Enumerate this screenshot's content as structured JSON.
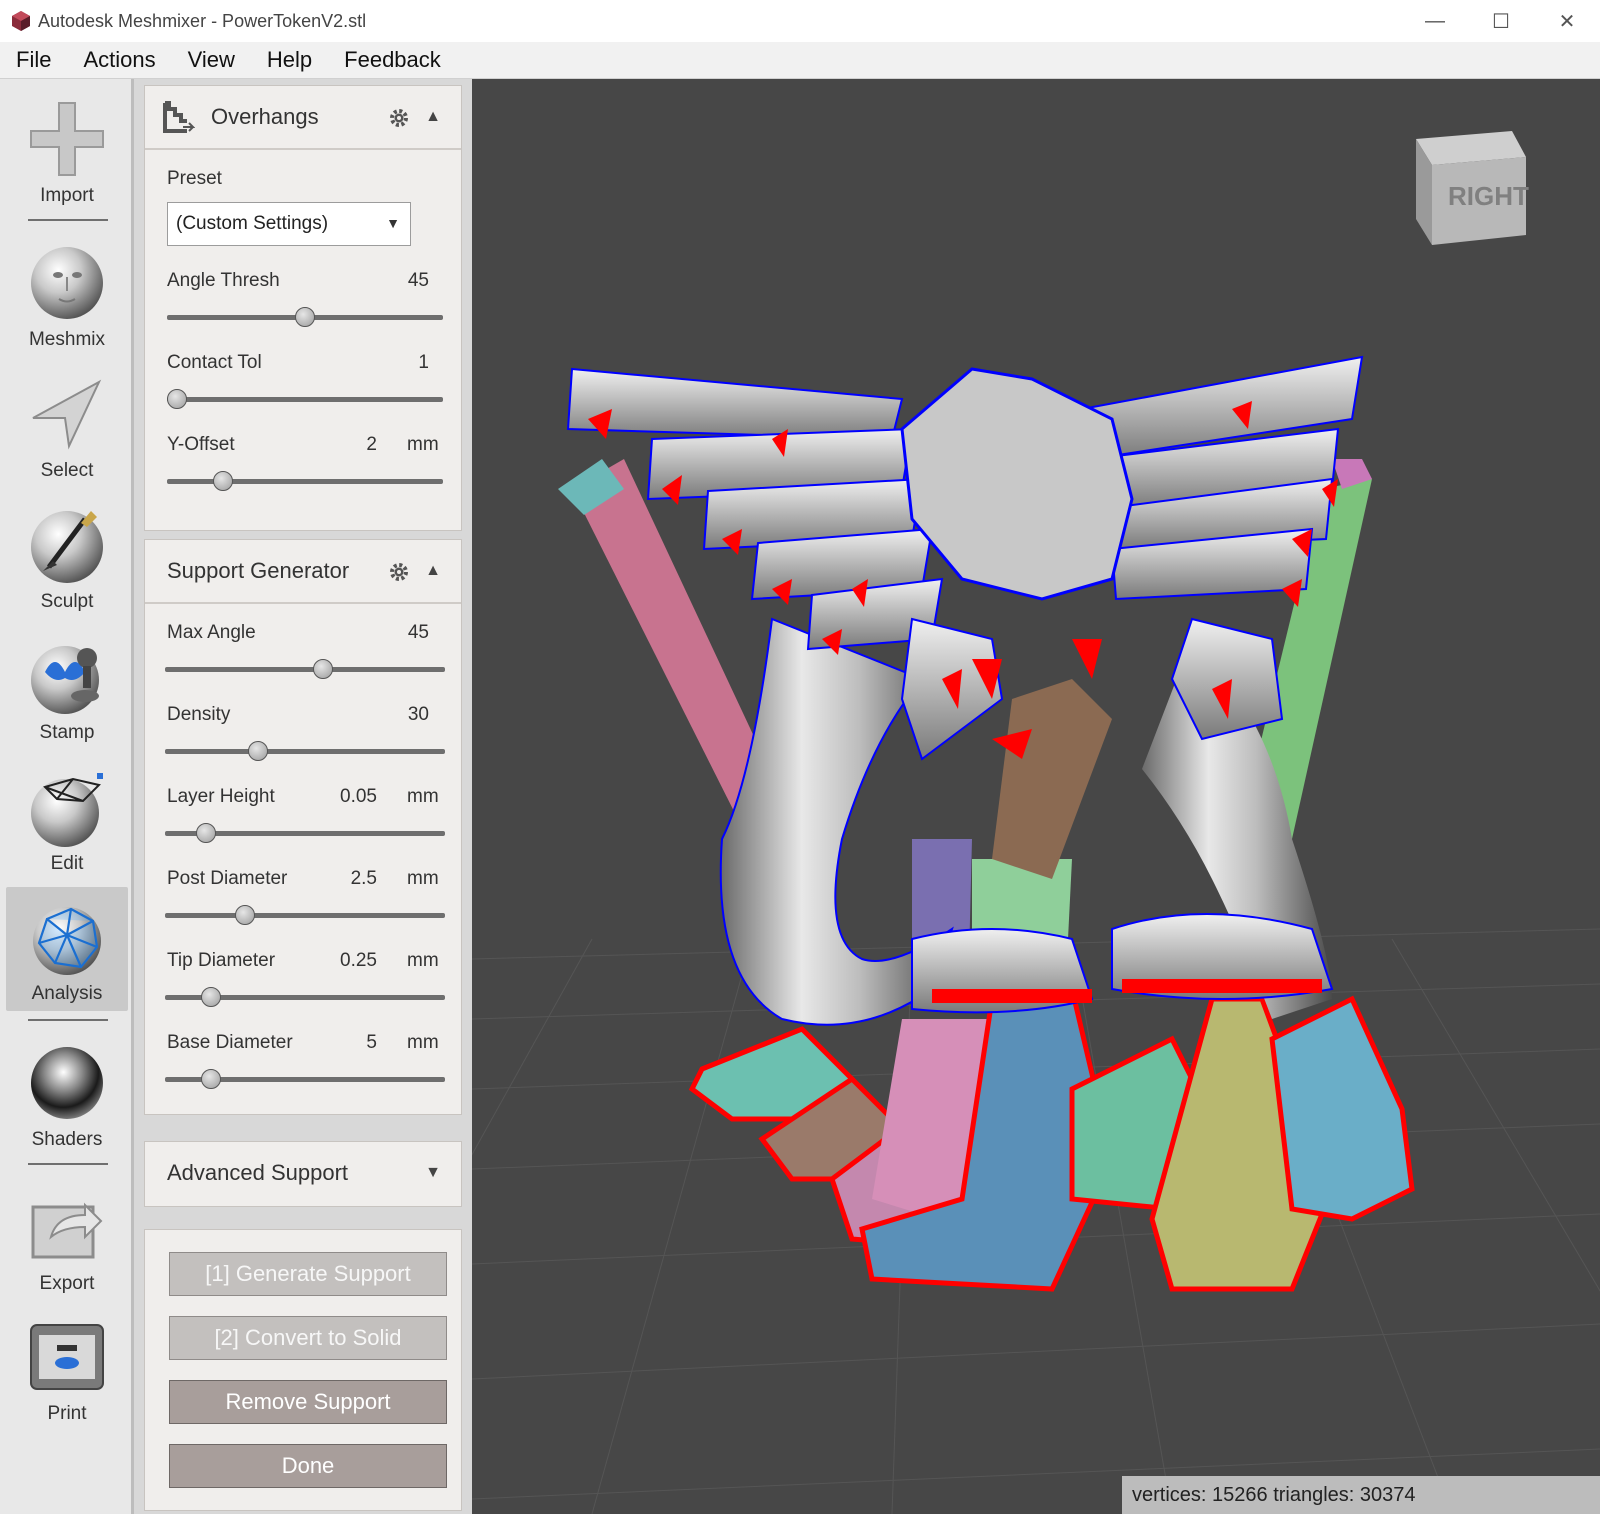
{
  "window": {
    "title": "Autodesk Meshmixer - PowerTokenV2.stl",
    "minimize": "—",
    "maximize": "☐",
    "close": "✕"
  },
  "menu": [
    "File",
    "Actions",
    "View",
    "Help",
    "Feedback"
  ],
  "tools": [
    {
      "label": "Import",
      "icon": "plus-icon"
    },
    {
      "label": "Meshmix",
      "icon": "face-sphere-icon"
    },
    {
      "label": "Select",
      "icon": "cursor-arrow-icon"
    },
    {
      "label": "Sculpt",
      "icon": "brush-sphere-icon"
    },
    {
      "label": "Stamp",
      "icon": "stamp-sphere-icon"
    },
    {
      "label": "Edit",
      "icon": "edit-sphere-icon"
    },
    {
      "label": "Analysis",
      "icon": "analysis-sphere-icon",
      "active": true
    },
    {
      "label": "Shaders",
      "icon": "shader-sphere-icon"
    },
    {
      "label": "Export",
      "icon": "export-icon"
    },
    {
      "label": "Print",
      "icon": "printer-icon"
    }
  ],
  "overhangs": {
    "title": "Overhangs",
    "preset_label": "Preset",
    "preset_value": "(Custom Settings)",
    "angle_thresh": {
      "label": "Angle Thresh",
      "value": "45",
      "level": 0.5
    },
    "contact_tol": {
      "label": "Contact Tol",
      "value": "1",
      "level": 0.0
    },
    "y_offset": {
      "label": "Y-Offset",
      "value": "2",
      "unit": "mm",
      "level": 0.18
    }
  },
  "support_generator": {
    "title": "Support Generator",
    "max_angle": {
      "label": "Max Angle",
      "value": "45",
      "level": 0.57
    },
    "density": {
      "label": "Density",
      "value": "30",
      "level": 0.32
    },
    "layer_height": {
      "label": "Layer Height",
      "value": "0.05",
      "unit": "mm",
      "level": 0.12
    },
    "post_diameter": {
      "label": "Post Diameter",
      "value": "2.5",
      "unit": "mm",
      "level": 0.27
    },
    "tip_diameter": {
      "label": "Tip Diameter",
      "value": "0.25",
      "unit": "mm",
      "level": 0.14
    },
    "base_diameter": {
      "label": "Base Diameter",
      "value": "5",
      "unit": "mm",
      "level": 0.14
    }
  },
  "advanced_support": {
    "title": "Advanced Support"
  },
  "buttons": {
    "generate": "[1] Generate Support",
    "convert": "[2] Convert to Solid",
    "remove": "Remove Support",
    "done": "Done"
  },
  "viewcube": {
    "face": "RIGHT"
  },
  "status": "vertices: 15266 triangles: 30374",
  "colors": {
    "viewport_bg": "#474747",
    "overhang_highlight": "#ff0000",
    "boundary_outline": "#0000ff",
    "button_bg": "#a89e9b"
  }
}
